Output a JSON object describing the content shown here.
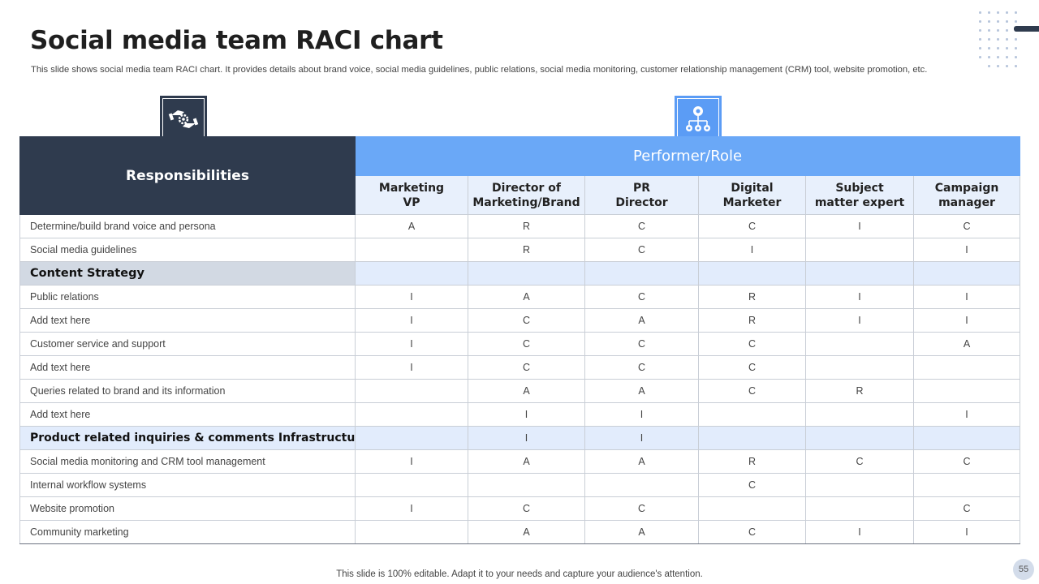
{
  "header": {
    "title": "Social media team RACI chart",
    "subtitle": "This slide shows social media team RACI chart. It provides details about brand voice, social media guidelines, public relations, social media monitoring, customer relationship management (CRM) tool, website promotion, etc."
  },
  "icons": {
    "responsibilities": "handshake-gear-icon",
    "performer": "org-chart-icon"
  },
  "table": {
    "responsibilities_label": "Responsibilities",
    "performer_label": "Performer/Role",
    "roles": [
      [
        "Marketing",
        "VP"
      ],
      [
        "Director of",
        "Marketing/Brand"
      ],
      [
        "PR",
        "Director"
      ],
      [
        "Digital",
        "Marketer"
      ],
      [
        "Subject",
        "matter expert"
      ],
      [
        "Campaign",
        "manager"
      ]
    ],
    "rows": [
      {
        "label": "Determine/build  brand voice  and persona",
        "section": false,
        "cells": [
          "A",
          "R",
          "C",
          "C",
          "I",
          "C"
        ]
      },
      {
        "label": "Social media guidelines",
        "section": false,
        "cells": [
          "",
          "R",
          "C",
          "I",
          "",
          "I"
        ]
      },
      {
        "label": "Content Strategy",
        "section": true,
        "cells": [
          "",
          "",
          "",
          "",
          "",
          ""
        ]
      },
      {
        "label": "Public relations",
        "section": false,
        "cells": [
          "I",
          "A",
          "C",
          "R",
          "I",
          "I"
        ]
      },
      {
        "label": "Add text here",
        "section": false,
        "cells": [
          "I",
          "C",
          "A",
          "R",
          "I",
          "I"
        ]
      },
      {
        "label": "Customer  service  and  support",
        "section": false,
        "cells": [
          "I",
          "C",
          "C",
          "C",
          "",
          "A"
        ]
      },
      {
        "label": "Add text here",
        "section": false,
        "cells": [
          "I",
          "C",
          "C",
          "C",
          "",
          ""
        ]
      },
      {
        "label": "Queries  related to brand and its information",
        "section": false,
        "cells": [
          "",
          "A",
          "A",
          "C",
          "R",
          ""
        ]
      },
      {
        "label": "Add text here",
        "section": false,
        "cells": [
          "",
          "I",
          "I",
          "",
          "",
          "I"
        ]
      },
      {
        "label": "Product related inquiries & comments Infrastructure",
        "section": true,
        "cells": [
          "",
          "I",
          "I",
          "",
          "",
          ""
        ]
      },
      {
        "label": "Social media monitoring and CRM tool management",
        "section": false,
        "cells": [
          "I",
          "A",
          "A",
          "R",
          "C",
          "C"
        ]
      },
      {
        "label": "Internal  workflow  systems",
        "section": false,
        "cells": [
          "",
          "",
          "",
          "C",
          "",
          ""
        ]
      },
      {
        "label": "Website promotion",
        "section": false,
        "cells": [
          "I",
          "C",
          "C",
          "",
          "",
          "C"
        ]
      },
      {
        "label": "Community  marketing",
        "section": false,
        "cells": [
          "",
          "A",
          "A",
          "C",
          "I",
          "I"
        ]
      }
    ]
  },
  "footer": {
    "note": "This slide is 100% editable. Adapt it to your needs and capture your audience's attention.",
    "page_number": "55"
  },
  "colors": {
    "dark_navy": "#2f3b4e",
    "accent_blue": "#6aa8f7",
    "light_blue": "#e8f0fc",
    "section_gray": "#d2d9e3"
  }
}
